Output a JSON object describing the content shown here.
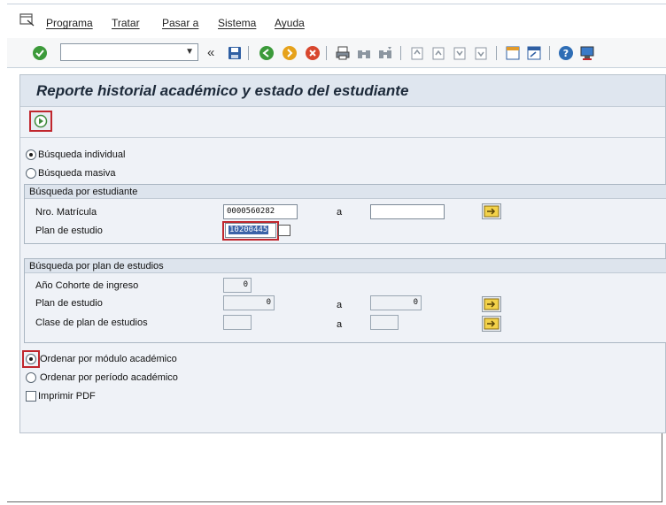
{
  "menu": {
    "items": [
      "Programa",
      "Tratar",
      "Pasar a",
      "Sistema",
      "Ayuda"
    ]
  },
  "toolbar": {
    "command_value": "",
    "back_glyph": "«",
    "icons": [
      "check-icon",
      "save-icon",
      "back-green-icon",
      "exit-yellow-icon",
      "cancel-red-icon",
      "print-icon",
      "find-icon",
      "find-next-icon",
      "first-page-icon",
      "prev-page-icon",
      "next-page-icon",
      "last-page-icon",
      "new-session-icon",
      "shortcut-icon",
      "help-icon",
      "customize-layout-icon"
    ]
  },
  "screen": {
    "title": "Reporte historial académico y estado del estudiante"
  },
  "search_mode": {
    "individual_label": "Búsqueda individual",
    "massive_label": "Búsqueda masiva",
    "selected": "individual"
  },
  "student_group": {
    "title": "Búsqueda por estudiante",
    "matricula_label": "Nro. Matrícula",
    "matricula_value": "0000560282",
    "to_label": "a",
    "matricula_to_value": "",
    "plan_label": "Plan de estudio",
    "plan_value": "10200445"
  },
  "plan_group": {
    "title": "Búsqueda por plan de estudios",
    "cohort_label": "Año Cohorte de ingreso",
    "cohort_value": "0",
    "plan_label": "Plan de estudio",
    "plan_value": "0",
    "to_label": "a",
    "plan_to_value": "0",
    "class_label": "Clase de plan de estudios",
    "class_value": "",
    "class_to_value": ""
  },
  "ordering": {
    "by_module_label": "Ordenar por módulo académico",
    "by_period_label": "Ordenar por período académico",
    "selected": "module"
  },
  "pdf": {
    "label": "Imprimir PDF",
    "checked": false
  },
  "colors": {
    "highlight_red": "#c0262d",
    "title_bar": "#dfe6ef",
    "panel_bg": "#eff2f7",
    "selection_blue": "#3b63a8"
  }
}
